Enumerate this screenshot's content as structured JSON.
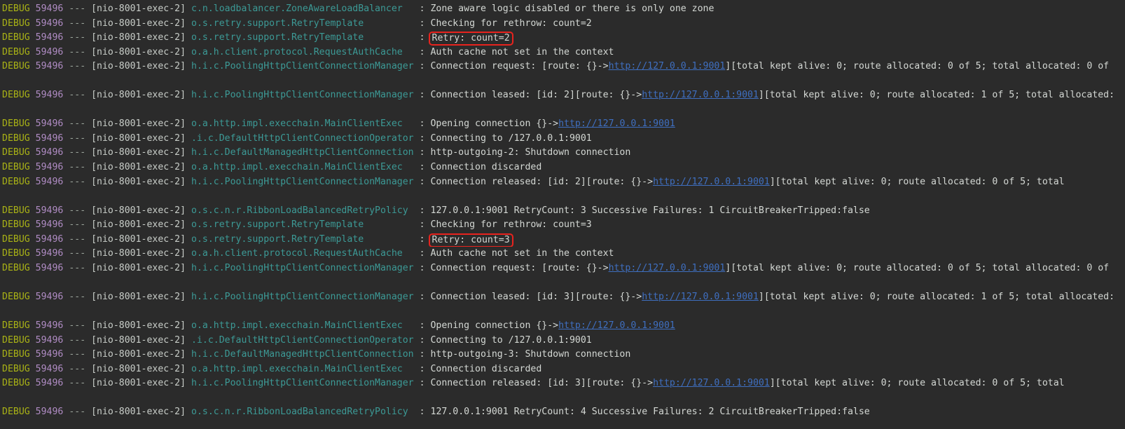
{
  "console": {
    "background_color": "#2b2b2b",
    "colors": {
      "level": "#a9b216",
      "pid": "#b08cc4",
      "dashes": "#9aa39a",
      "thread": "#c8cdc8",
      "logger": "#3c9a96",
      "message": "#d4d8d4",
      "link": "#3f6fc0",
      "highlight_border": "#e8231e"
    },
    "level": "DEBUG",
    "pid": "59496",
    "dashes": "---",
    "thread": "[nio-8001-exec-2]",
    "separator": ":",
    "link_text": "http://127.0.0.1:9001"
  },
  "lines": [
    {
      "type": "log",
      "logger": "c.n.loadbalancer.ZoneAwareLoadBalancer",
      "message": "Zone aware logic disabled or there is only one zone"
    },
    {
      "type": "log",
      "logger": "o.s.retry.support.RetryTemplate",
      "message": "Checking for rethrow: count=2"
    },
    {
      "type": "log",
      "logger": "o.s.retry.support.RetryTemplate",
      "message": "Retry: count=2",
      "highlight": true
    },
    {
      "type": "log",
      "logger": "o.a.h.client.protocol.RequestAuthCache",
      "message": "Auth cache not set in the context"
    },
    {
      "type": "log",
      "logger": "h.i.c.PoolingHttpClientConnectionManager",
      "msg_pre": "Connection request: [route: {}->",
      "msg_link": "http://127.0.0.1:9001",
      "msg_post": "][total kept alive: 0; route allocated: 0 of 5; total allocated: 0 of"
    },
    {
      "type": "blank"
    },
    {
      "type": "log",
      "logger": "h.i.c.PoolingHttpClientConnectionManager",
      "msg_pre": "Connection leased: [id: 2][route: {}->",
      "msg_link": "http://127.0.0.1:9001",
      "msg_post": "][total kept alive: 0; route allocated: 1 of 5; total allocated:"
    },
    {
      "type": "blank"
    },
    {
      "type": "log",
      "logger": "o.a.http.impl.execchain.MainClientExec",
      "msg_pre": "Opening connection {}->",
      "msg_link": "http://127.0.0.1:9001",
      "msg_post": ""
    },
    {
      "type": "log",
      "logger": ".i.c.DefaultHttpClientConnectionOperator",
      "message": "Connecting to /127.0.0.1:9001"
    },
    {
      "type": "log",
      "logger": "h.i.c.DefaultManagedHttpClientConnection",
      "message": "http-outgoing-2: Shutdown connection"
    },
    {
      "type": "log",
      "logger": "o.a.http.impl.execchain.MainClientExec",
      "message": "Connection discarded"
    },
    {
      "type": "log",
      "logger": "h.i.c.PoolingHttpClientConnectionManager",
      "msg_pre": "Connection released: [id: 2][route: {}->",
      "msg_link": "http://127.0.0.1:9001",
      "msg_post": "][total kept alive: 0; route allocated: 0 of 5; total"
    },
    {
      "type": "blank"
    },
    {
      "type": "log",
      "logger": "o.s.c.n.r.RibbonLoadBalancedRetryPolicy",
      "message": "127.0.0.1:9001 RetryCount: 3 Successive Failures: 1 CircuitBreakerTripped:false"
    },
    {
      "type": "log",
      "logger": "o.s.retry.support.RetryTemplate",
      "message": "Checking for rethrow: count=3"
    },
    {
      "type": "log",
      "logger": "o.s.retry.support.RetryTemplate",
      "message": "Retry: count=3",
      "highlight": true
    },
    {
      "type": "log",
      "logger": "o.a.h.client.protocol.RequestAuthCache",
      "message": "Auth cache not set in the context"
    },
    {
      "type": "log",
      "logger": "h.i.c.PoolingHttpClientConnectionManager",
      "msg_pre": "Connection request: [route: {}->",
      "msg_link": "http://127.0.0.1:9001",
      "msg_post": "][total kept alive: 0; route allocated: 0 of 5; total allocated: 0 of"
    },
    {
      "type": "blank"
    },
    {
      "type": "log",
      "logger": "h.i.c.PoolingHttpClientConnectionManager",
      "msg_pre": "Connection leased: [id: 3][route: {}->",
      "msg_link": "http://127.0.0.1:9001",
      "msg_post": "][total kept alive: 0; route allocated: 1 of 5; total allocated:"
    },
    {
      "type": "blank"
    },
    {
      "type": "log",
      "logger": "o.a.http.impl.execchain.MainClientExec",
      "msg_pre": "Opening connection {}->",
      "msg_link": "http://127.0.0.1:9001",
      "msg_post": ""
    },
    {
      "type": "log",
      "logger": ".i.c.DefaultHttpClientConnectionOperator",
      "message": "Connecting to /127.0.0.1:9001"
    },
    {
      "type": "log",
      "logger": "h.i.c.DefaultManagedHttpClientConnection",
      "message": "http-outgoing-3: Shutdown connection"
    },
    {
      "type": "log",
      "logger": "o.a.http.impl.execchain.MainClientExec",
      "message": "Connection discarded"
    },
    {
      "type": "log",
      "logger": "h.i.c.PoolingHttpClientConnectionManager",
      "msg_pre": "Connection released: [id: 3][route: {}->",
      "msg_link": "http://127.0.0.1:9001",
      "msg_post": "][total kept alive: 0; route allocated: 0 of 5; total"
    },
    {
      "type": "blank"
    },
    {
      "type": "log",
      "logger": "o.s.c.n.r.RibbonLoadBalancedRetryPolicy",
      "message": "127.0.0.1:9001 RetryCount: 4 Successive Failures: 2 CircuitBreakerTripped:false"
    }
  ]
}
